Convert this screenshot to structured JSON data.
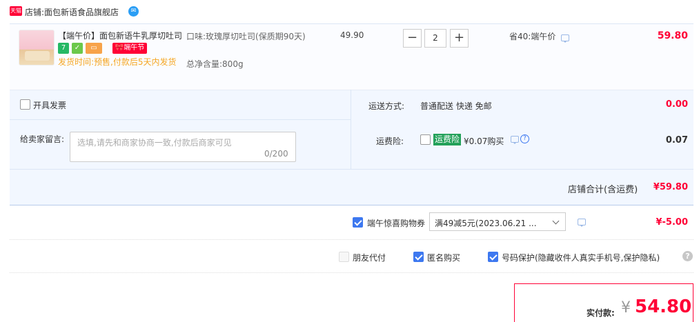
{
  "store": {
    "logo_text": "天猫",
    "label": "店铺:面包新语食品旗舰店"
  },
  "item": {
    "title": "【端午价】面包新语牛乳厚切吐司",
    "badges": {
      "seven": "7",
      "festival": "🎀端午节"
    },
    "ship_note": "发货时间:预售,付款后5天内发货",
    "flavor": "口味:玫瑰厚切吐司(保质期90天)",
    "weight": "总净含量:800g",
    "unit_price": "49.90",
    "quantity": "2",
    "minus": "−",
    "plus": "+",
    "save_note": "省40:端午价",
    "total": "59.80"
  },
  "invoice": {
    "label": "开具发票"
  },
  "shipping": {
    "label": "运送方式:",
    "value": "普通配送 快递 免邮",
    "cost": "0.00"
  },
  "memo": {
    "label": "给卖家留言:",
    "placeholder": "选填,请先和商家协商一致,付款后商家可见",
    "count": "0/200"
  },
  "insurance": {
    "label": "运费险:",
    "tag": "运费险",
    "price": "¥0.07购买",
    "help": "?",
    "cost": "0.07"
  },
  "subtotal": {
    "label": "店铺合计(含运费)",
    "value": "¥59.80"
  },
  "coupon": {
    "label": "端午惊喜购物券",
    "selected": "满49减5元(2023.06.21 ...",
    "value": "¥-5.00"
  },
  "options": {
    "friend_pay": "朋友代付",
    "anonymous": "匿名购买",
    "privacy": "号码保护(隐藏收件人真实手机号,保护隐私)",
    "help": "?"
  },
  "payment": {
    "label": "实付款:",
    "currency": "¥",
    "amount": "54.80"
  },
  "colors": {
    "accent": "#ff0036",
    "panel": "#f2f7ff",
    "check": "#3d78f0",
    "insurance_tag": "#23a159"
  }
}
